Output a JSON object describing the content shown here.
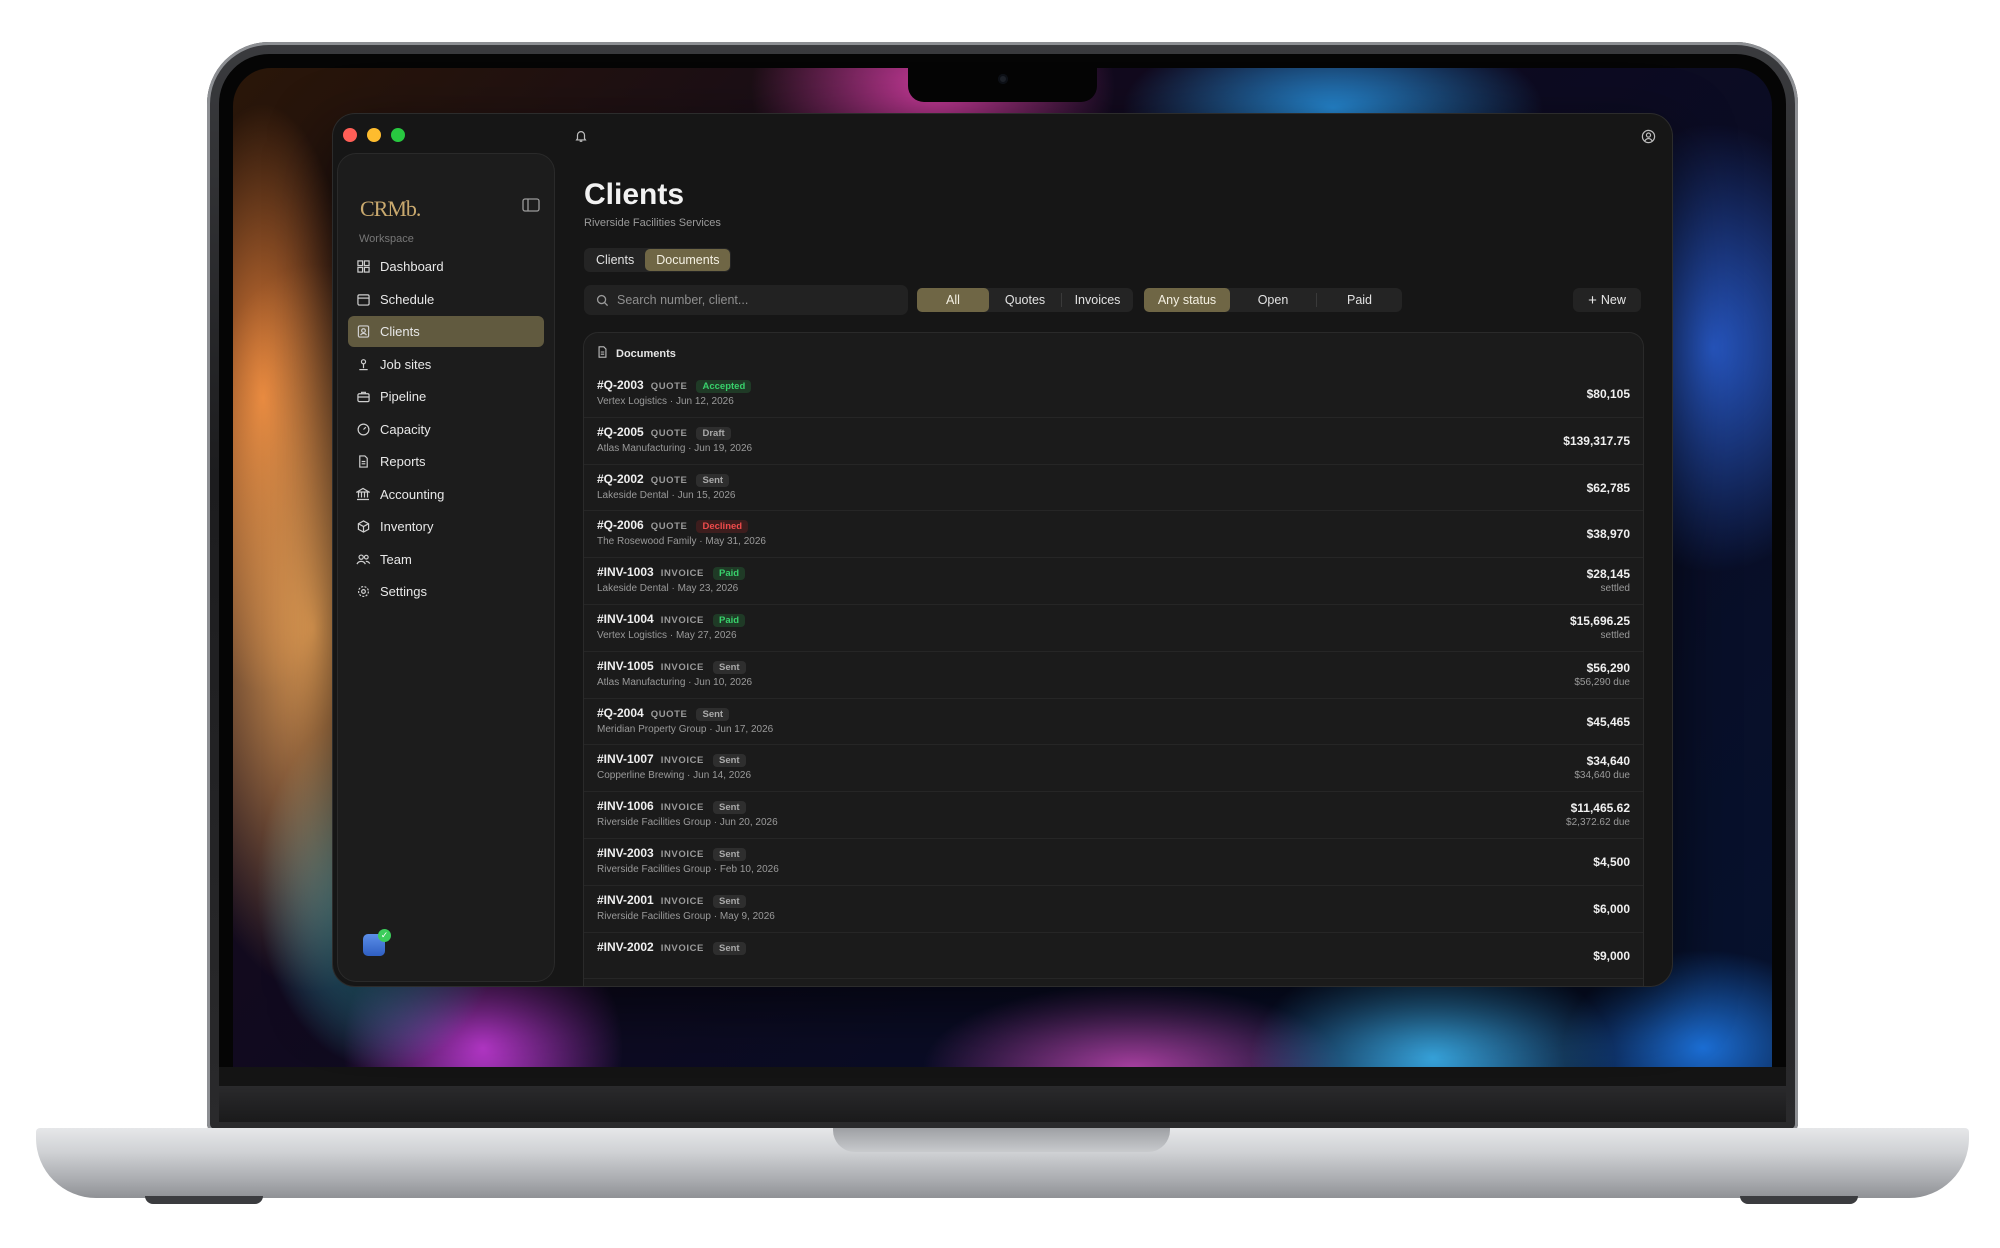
{
  "window": {
    "title": "Clients"
  },
  "brand": {
    "logo_text": "CRMb."
  },
  "sidebar": {
    "section_label": "Workspace",
    "items": [
      {
        "label": "Dashboard",
        "icon": "grid-icon",
        "active": false
      },
      {
        "label": "Schedule",
        "icon": "calendar-icon",
        "active": false
      },
      {
        "label": "Clients",
        "icon": "contact-card-icon",
        "active": true
      },
      {
        "label": "Job sites",
        "icon": "location-pin-icon",
        "active": false
      },
      {
        "label": "Pipeline",
        "icon": "briefcase-icon",
        "active": false
      },
      {
        "label": "Capacity",
        "icon": "gauge-icon",
        "active": false
      },
      {
        "label": "Reports",
        "icon": "document-icon",
        "active": false
      },
      {
        "label": "Accounting",
        "icon": "bank-icon",
        "active": false
      },
      {
        "label": "Inventory",
        "icon": "box-icon",
        "active": false
      },
      {
        "label": "Team",
        "icon": "people-icon",
        "active": false
      },
      {
        "label": "Settings",
        "icon": "gear-icon",
        "active": false
      }
    ]
  },
  "header": {
    "title": "Clients",
    "subtitle": "Riverside Facilities Services",
    "tabs": [
      {
        "label": "Clients",
        "active": false
      },
      {
        "label": "Documents",
        "active": true
      }
    ]
  },
  "toolbar": {
    "search_placeholder": "Search number, client...",
    "type_filters": [
      {
        "label": "All",
        "active": true
      },
      {
        "label": "Quotes",
        "active": false
      },
      {
        "label": "Invoices",
        "active": false
      }
    ],
    "status_filters": [
      {
        "label": "Any status",
        "active": true
      },
      {
        "label": "Open",
        "active": false
      },
      {
        "label": "Paid",
        "active": false
      }
    ],
    "new_label": "New"
  },
  "documents": {
    "title": "Documents",
    "rows": [
      {
        "number": "#Q-2003",
        "kind": "QUOTE",
        "status": "Accepted",
        "status_class": "accepted",
        "client": "Vertex Logistics",
        "date": "Jun 12, 2026",
        "amount": "$80,105",
        "amount_sub": ""
      },
      {
        "number": "#Q-2005",
        "kind": "QUOTE",
        "status": "Draft",
        "status_class": "draft",
        "client": "Atlas Manufacturing",
        "date": "Jun 19, 2026",
        "amount": "$139,317.75",
        "amount_sub": ""
      },
      {
        "number": "#Q-2002",
        "kind": "QUOTE",
        "status": "Sent",
        "status_class": "sent",
        "client": "Lakeside Dental",
        "date": "Jun 15, 2026",
        "amount": "$62,785",
        "amount_sub": ""
      },
      {
        "number": "#Q-2006",
        "kind": "QUOTE",
        "status": "Declined",
        "status_class": "declined",
        "client": "The Rosewood Family",
        "date": "May 31, 2026",
        "amount": "$38,970",
        "amount_sub": ""
      },
      {
        "number": "#INV-1003",
        "kind": "INVOICE",
        "status": "Paid",
        "status_class": "paid",
        "client": "Lakeside Dental",
        "date": "May 23, 2026",
        "amount": "$28,145",
        "amount_sub": "settled"
      },
      {
        "number": "#INV-1004",
        "kind": "INVOICE",
        "status": "Paid",
        "status_class": "paid",
        "client": "Vertex Logistics",
        "date": "May 27, 2026",
        "amount": "$15,696.25",
        "amount_sub": "settled"
      },
      {
        "number": "#INV-1005",
        "kind": "INVOICE",
        "status": "Sent",
        "status_class": "sent",
        "client": "Atlas Manufacturing",
        "date": "Jun 10, 2026",
        "amount": "$56,290",
        "amount_sub": "$56,290 due"
      },
      {
        "number": "#Q-2004",
        "kind": "QUOTE",
        "status": "Sent",
        "status_class": "sent",
        "client": "Meridian Property Group",
        "date": "Jun 17, 2026",
        "amount": "$45,465",
        "amount_sub": ""
      },
      {
        "number": "#INV-1007",
        "kind": "INVOICE",
        "status": "Sent",
        "status_class": "sent",
        "client": "Copperline Brewing",
        "date": "Jun 14, 2026",
        "amount": "$34,640",
        "amount_sub": "$34,640 due"
      },
      {
        "number": "#INV-1006",
        "kind": "INVOICE",
        "status": "Sent",
        "status_class": "sent",
        "client": "Riverside Facilities Group",
        "date": "Jun 20, 2026",
        "amount": "$11,465.62",
        "amount_sub": "$2,372.62 due"
      },
      {
        "number": "#INV-2003",
        "kind": "INVOICE",
        "status": "Sent",
        "status_class": "sent",
        "client": "Riverside Facilities Group",
        "date": "Feb 10, 2026",
        "amount": "$4,500",
        "amount_sub": ""
      },
      {
        "number": "#INV-2001",
        "kind": "INVOICE",
        "status": "Sent",
        "status_class": "sent",
        "client": "Riverside Facilities Group",
        "date": "May 9, 2026",
        "amount": "$6,000",
        "amount_sub": ""
      },
      {
        "number": "#INV-2002",
        "kind": "INVOICE",
        "status": "Sent",
        "status_class": "sent",
        "client": "",
        "date": "",
        "amount": "$9,000",
        "amount_sub": ""
      }
    ]
  },
  "colors": {
    "accent": "#6f6645",
    "sidebar_active": "#615a3f",
    "logo": "#c9a96e",
    "paid_green": "#38d06b",
    "declined_red": "#ef4b4b"
  }
}
